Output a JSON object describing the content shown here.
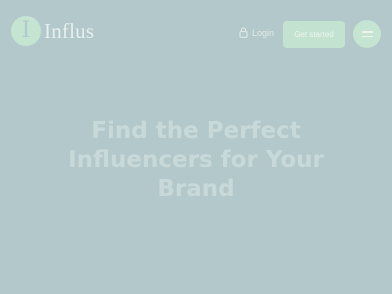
{
  "header": {
    "logo": {
      "badge_letter": "I",
      "name": "Influs"
    },
    "login": {
      "label": "Login",
      "icon": "lock-icon"
    },
    "get_started_label": "Get started",
    "menu_icon": "hamburger-menu-icon"
  },
  "hero": {
    "title": "Find the Perfect Influencers for Your Brand"
  },
  "colors": {
    "background": "#b3c8ca",
    "accent": "#c6e4d2",
    "light_text": "#e6efee",
    "hero_text": "#c8d9d9"
  }
}
